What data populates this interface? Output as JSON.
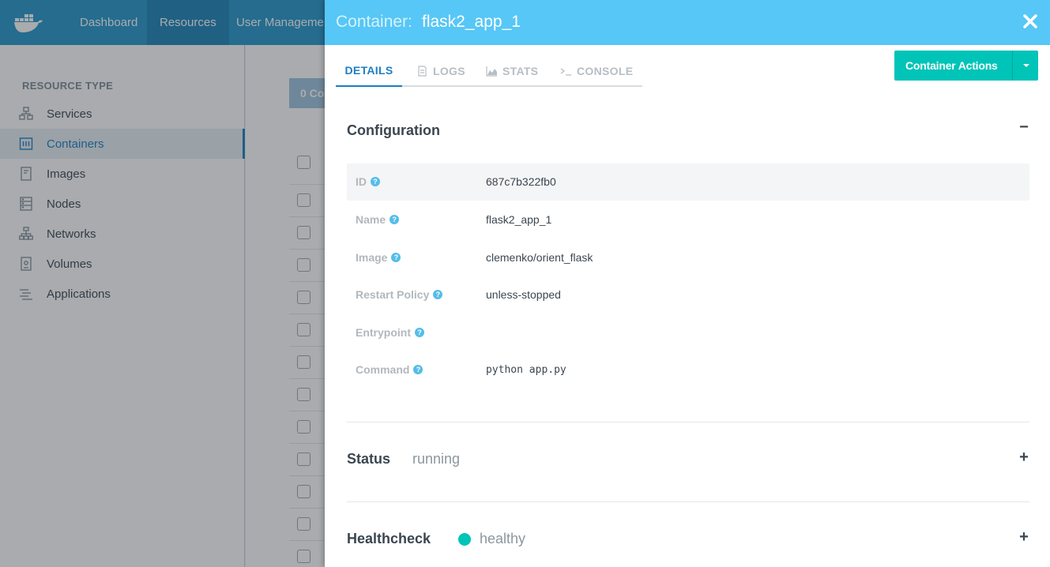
{
  "nav": {
    "logo_icon": "docker-whale-icon",
    "items": [
      {
        "label": "Dashboard"
      },
      {
        "label": "Resources"
      },
      {
        "label": "User Managemen"
      }
    ]
  },
  "sidebar": {
    "heading": "RESOURCE TYPE",
    "items": [
      {
        "label": "Services",
        "icon": "services-icon"
      },
      {
        "label": "Containers",
        "icon": "containers-icon"
      },
      {
        "label": "Images",
        "icon": "images-icon"
      },
      {
        "label": "Nodes",
        "icon": "nodes-icon"
      },
      {
        "label": "Networks",
        "icon": "networks-icon"
      },
      {
        "label": "Volumes",
        "icon": "volumes-icon"
      },
      {
        "label": "Applications",
        "icon": "applications-icon"
      }
    ]
  },
  "main": {
    "top_button_label": "0 Co"
  },
  "drawer": {
    "title_prefix": "Container:",
    "title_name": "flask2_app_1",
    "tabs": [
      {
        "label": "DETAILS"
      },
      {
        "label": "LOGS",
        "icon": "document-icon"
      },
      {
        "label": "STATS",
        "icon": "area-chart-icon"
      },
      {
        "label": "CONSOLE",
        "icon": "terminal-icon"
      }
    ],
    "actions_label": "Container Actions",
    "configuration": {
      "title": "Configuration",
      "toggle": "−",
      "rows": [
        {
          "label": "ID",
          "value": "687c7b322fb0"
        },
        {
          "label": "Name",
          "value": "flask2_app_1"
        },
        {
          "label": "Image",
          "value": "clemenko/orient_flask"
        },
        {
          "label": "Restart Policy",
          "value": "unless-stopped"
        },
        {
          "label": "Entrypoint",
          "value": ""
        },
        {
          "label": "Command",
          "value": "python app.py"
        }
      ]
    },
    "status": {
      "title": "Status",
      "value": "running",
      "toggle": "+"
    },
    "healthcheck": {
      "title": "Healthcheck",
      "value": "healthy",
      "toggle": "+",
      "color": "#00c4b7"
    }
  },
  "colors": {
    "nav": "#2496cc",
    "drawer_header": "#56c7f6",
    "accent": "#1c7ec2",
    "action": "#00c4b7"
  }
}
